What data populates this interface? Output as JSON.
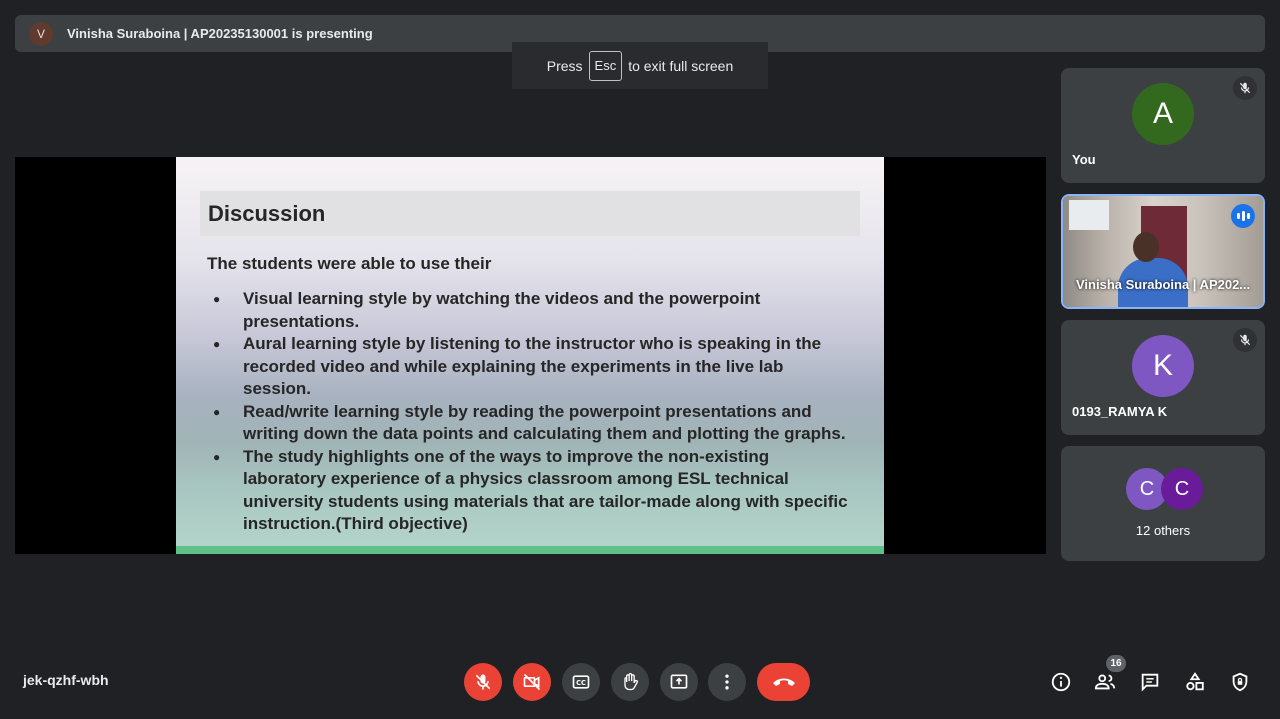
{
  "presenting_bar": {
    "avatar_letter": "V",
    "text": "Vinisha Suraboina | AP20235130001 is presenting"
  },
  "esc_toast": {
    "press": "Press",
    "key": "Esc",
    "suffix": "to exit full screen"
  },
  "slide": {
    "title": "Discussion",
    "intro": "The students were able to use their",
    "bullets": [
      "Visual learning style by watching the videos and the powerpoint presentations.",
      "Aural learning style by listening to the instructor who is speaking in the recorded video and while explaining the experiments in the live lab session.",
      "Read/write learning style by reading the powerpoint presentations and writing down the data points and calculating them and plotting the graphs.",
      "The study highlights one of the ways to improve the non-existing laboratory experience of a physics classroom among ESL technical university students using materials that are tailor-made along with specific instruction.(Third objective)"
    ]
  },
  "participants": {
    "you": {
      "letter": "A",
      "name": "You",
      "color": "#33691e"
    },
    "presenter": {
      "name": "Vinisha Suraboina | AP202..."
    },
    "ramya": {
      "letter": "K",
      "name": "0193_RAMYA K",
      "color": "#7e57c2"
    },
    "others": {
      "letter1": "C",
      "letter2": "C",
      "label": "12 others"
    }
  },
  "bottom_bar": {
    "meeting_code": "jek-qzhf-wbh",
    "participant_count": "16",
    "colors": {
      "danger": "#ea4335",
      "button": "#3c4043"
    }
  }
}
